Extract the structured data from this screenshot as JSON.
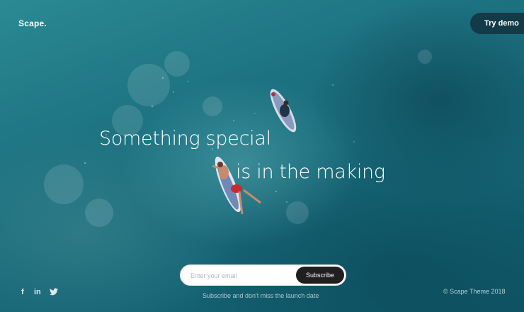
{
  "brand": {
    "logo": "Scape."
  },
  "header": {
    "demo_label": "Try demo"
  },
  "headline": {
    "line1": "Something special",
    "line2": "is in the making"
  },
  "subscribe": {
    "placeholder": "Enter your email",
    "button_label": "Subscribe",
    "note": "Subscribe and don't miss the launch date"
  },
  "social": {
    "facebook_glyph": "f",
    "linkedin_glyph": "in",
    "twitter_glyph": "twitter-icon"
  },
  "footer": {
    "copyright": "© Scape Theme 2018"
  },
  "colors": {
    "ocean": "#1c6f7c",
    "dark_button": "#123b47",
    "subscribe_button": "#1f1f1f",
    "text": "#ffffff"
  }
}
